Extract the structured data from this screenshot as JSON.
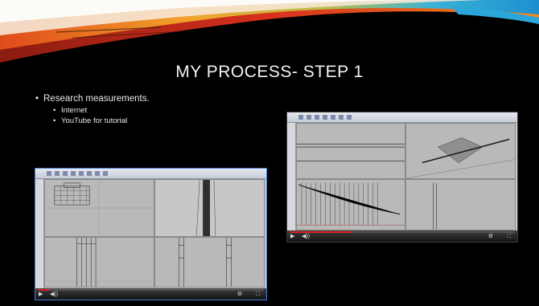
{
  "slide": {
    "title": "MY PROCESS- STEP 1",
    "bullets": [
      {
        "text": "Research measurements.",
        "sub": [
          "Internet",
          "YouTube for tutorial"
        ]
      }
    ]
  },
  "screenshots": [
    {
      "name": "rhino-video-left",
      "progress": 0.05
    },
    {
      "name": "rhino-video-right",
      "progress": 0.28
    }
  ],
  "colors": {
    "background": "#000000",
    "swoosh_orange": "#f28a1e",
    "swoosh_red": "#d8301c",
    "swoosh_blue": "#2aa7d8",
    "accent_border": "#4b7fd6"
  },
  "icons": [
    "play-icon",
    "volume-icon",
    "settings-icon",
    "fullscreen-icon"
  ]
}
